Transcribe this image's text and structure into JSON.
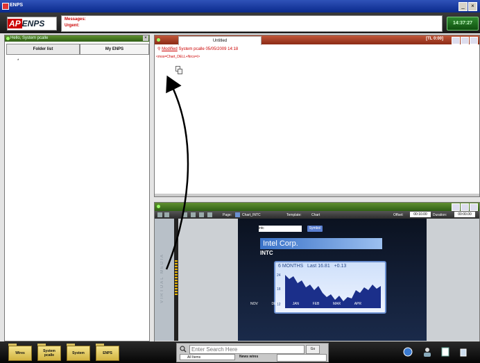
{
  "window": {
    "title": "ENPS"
  },
  "header": {
    "logo_ap": "AP",
    "logo_enps": "ENPS",
    "messages_label": "Messages:",
    "urgent_label": "Urgent:",
    "clock": "14:37:27"
  },
  "left_panel": {
    "title": "Hello, System pcalle",
    "tabs": [
      {
        "label": "Folder list"
      },
      {
        "label": "My ENPS"
      }
    ],
    "marker": "*"
  },
  "editor": {
    "tab_title": "Untitled",
    "timer": "[TL 0:00]",
    "modified_label": "Modified",
    "modified_rest": "System pcalle  05/05/2009 14:18",
    "mos_tag": "<mos=Chart_DELL+Nrcs=/>"
  },
  "preview": {
    "page_label": "Page:",
    "page_value": "Chart_INTC",
    "template_label": "Template:",
    "template_value": "Chart",
    "offset_label": "Offset:",
    "offset_value": "00:10.00",
    "duration_label": "Duration:",
    "duration_value": "00:00.00",
    "side_text": "VIRTUAL MEDIA",
    "stage": {
      "select_value": "intc",
      "button_label": "Symbol",
      "company": "Intel Corp.",
      "ticker": "INTC",
      "period": "6 MONTHS",
      "last_label": "Last",
      "last_value": "16.81",
      "change": "+0.13",
      "y_ticks": [
        "24",
        "18",
        "12"
      ],
      "months": [
        "NOV",
        "DEC",
        "JAN",
        "FEB",
        "MAR",
        "APR"
      ]
    }
  },
  "taskbar": {
    "folders": [
      "Wires",
      "System pcalle",
      "System",
      "ENPS"
    ],
    "search_placeholder": "Enter Search Here",
    "go_label": "Go",
    "scope_value": "All Items",
    "source_label": "News wires"
  }
}
